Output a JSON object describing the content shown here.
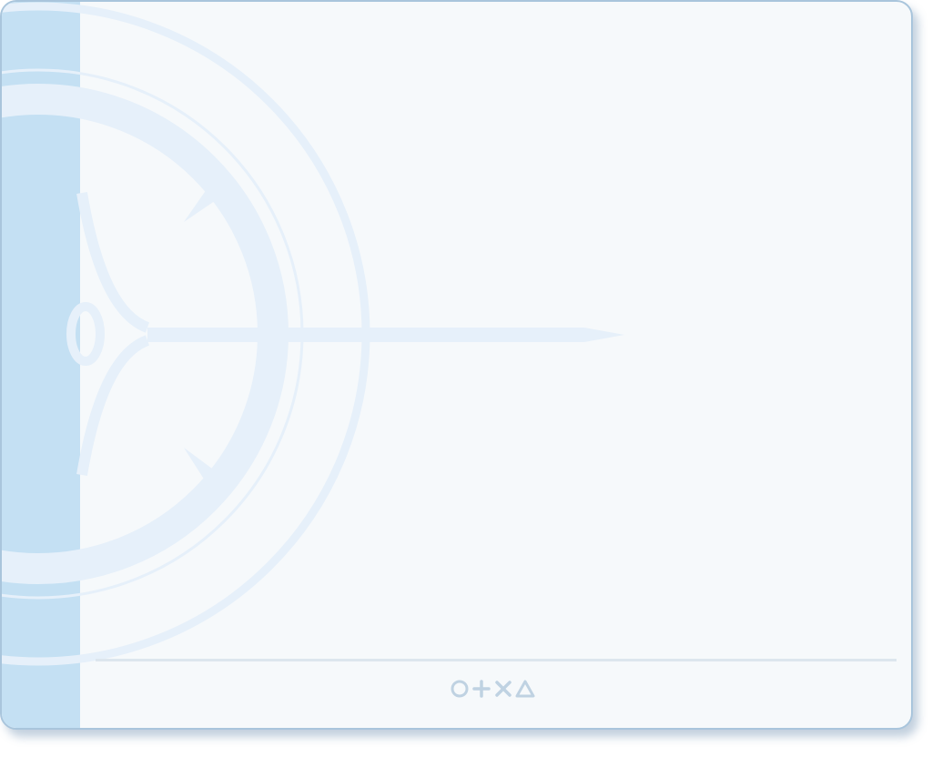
{
  "card": {
    "background": "#f6f9fb",
    "border_color": "#a9c5dc",
    "strip_color": "#c4e0f3"
  },
  "watermark": {
    "icon": "compass-watermark-icon",
    "color": "#e6f0fa"
  },
  "footer": {
    "icons": [
      "circle-icon",
      "plus-icon",
      "cross-icon",
      "triangle-icon"
    ],
    "icon_color": "#bfd2e2"
  }
}
